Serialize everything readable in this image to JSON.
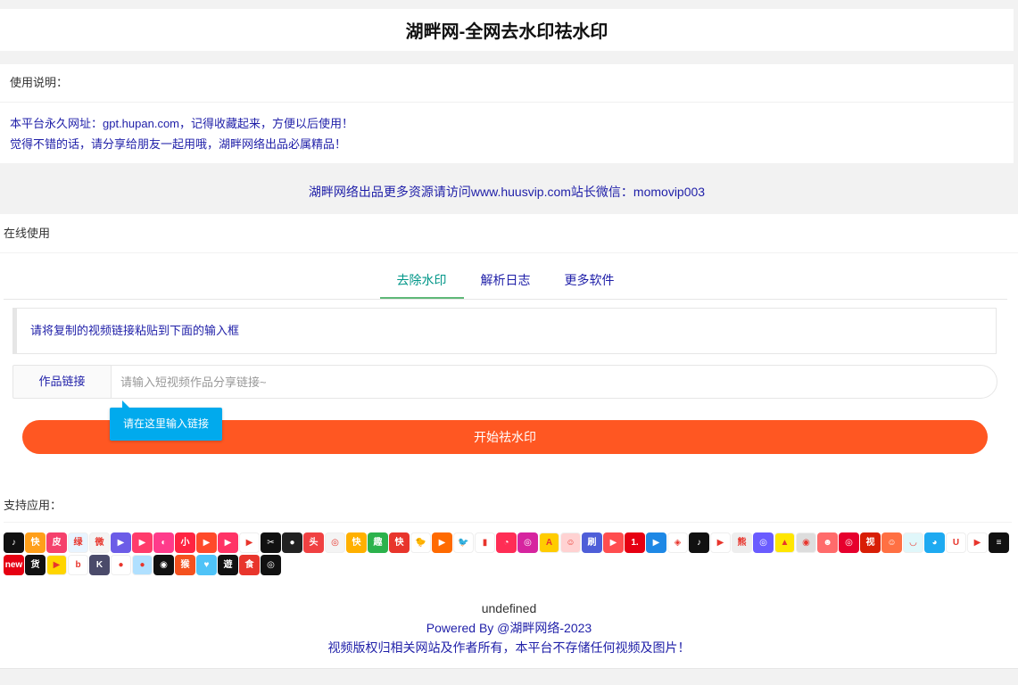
{
  "header": {
    "title": "湖畔网-全网去水印祛水印"
  },
  "notice": {
    "heading": "使用说明：",
    "line1": "本平台永久网址：gpt.hupan.com，记得收藏起来，方便以后使用！",
    "line2": "觉得不错的话，请分享给朋友一起用哦，湖畔网络出品必属精品！"
  },
  "promo": "湖畔网络出品更多资源请访问www.huusvip.com站长微信：momovip003",
  "online": {
    "heading": "在线使用",
    "tabs": [
      {
        "label": "去除水印",
        "active": true
      },
      {
        "label": "解析日志",
        "active": false
      },
      {
        "label": "更多软件",
        "active": false
      }
    ],
    "hint": "请将复制的视频链接粘贴到下面的输入框",
    "input_label": "作品链接",
    "input_placeholder": "请输入短视频作品分享链接~",
    "input_value": "",
    "tooltip": "请在这里输入链接",
    "start_button": "开始祛水印"
  },
  "support": {
    "heading": "支持应用：",
    "icons": [
      {
        "name": "douyin-icon",
        "bg": "#111111",
        "text": "♪"
      },
      {
        "name": "kuaishou-icon",
        "bg": "#ff9f1a",
        "text": "快"
      },
      {
        "name": "pipixia-icon",
        "bg": "#f5416c",
        "text": "皮"
      },
      {
        "name": "lvzhou-icon",
        "bg": "#e8f4ff",
        "text": "绿"
      },
      {
        "name": "weibo-icon",
        "bg": "#f4f4f4",
        "text": "微"
      },
      {
        "name": "weishi-icon",
        "bg": "#6c5ce7",
        "text": "▶"
      },
      {
        "name": "quanmin-icon",
        "bg": "#ff3b6b",
        "text": "▶"
      },
      {
        "name": "meipai-icon",
        "bg": "#ff3b8b",
        "text": "◐"
      },
      {
        "name": "xiaohongshu-icon",
        "bg": "#ff2442",
        "text": "小"
      },
      {
        "name": "haokan-icon",
        "bg": "#ff4a2a",
        "text": "▶"
      },
      {
        "name": "video-red-icon",
        "bg": "#ff3366",
        "text": "▶"
      },
      {
        "name": "play-icon",
        "bg": "#ffffff",
        "text": "▶"
      },
      {
        "name": "capcut-icon",
        "bg": "#111111",
        "text": "✂"
      },
      {
        "name": "record-icon",
        "bg": "#222222",
        "text": "●"
      },
      {
        "name": "toutiao-icon",
        "bg": "#f04142",
        "text": "头"
      },
      {
        "name": "qq-video-icon",
        "bg": "#f4f4f4",
        "text": "◎"
      },
      {
        "name": "kuaishou-yellow-icon",
        "bg": "#ffb000",
        "text": "快"
      },
      {
        "name": "qu-icon",
        "bg": "#2bb24c",
        "text": "趣"
      },
      {
        "name": "kuaibao-icon",
        "bg": "#e8352c",
        "text": "快"
      },
      {
        "name": "chick-icon",
        "bg": "#ffffff",
        "text": "🐤"
      },
      {
        "name": "play-orange-icon",
        "bg": "#ff6a00",
        "text": "▶"
      },
      {
        "name": "twitter-icon",
        "bg": "#ffffff",
        "text": "🐦"
      },
      {
        "name": "chart-icon",
        "bg": "#ffffff",
        "text": "▮"
      },
      {
        "name": "chat-icon",
        "bg": "#ff2d55",
        "text": "◔"
      },
      {
        "name": "instagram-icon",
        "bg": "#d6249f",
        "text": "◎"
      },
      {
        "name": "acfun-icon",
        "bg": "#ffcc00",
        "text": "A"
      },
      {
        "name": "face-icon",
        "bg": "#ffd2d2",
        "text": "☺"
      },
      {
        "name": "shua-icon",
        "bg": "#4e5ed8",
        "text": "刷"
      },
      {
        "name": "video-play-icon",
        "bg": "#ff4d4f",
        "text": "▶"
      },
      {
        "name": "one-icon",
        "bg": "#e60012",
        "text": "1."
      },
      {
        "name": "blue-play-icon",
        "bg": "#1e88e5",
        "text": "▶"
      },
      {
        "name": "iqiyi-icon",
        "bg": "#ffffff",
        "text": "◈"
      },
      {
        "name": "tiktok-icon",
        "bg": "#111111",
        "text": "♪"
      },
      {
        "name": "youtube-icon",
        "bg": "#ffffff",
        "text": "▶"
      },
      {
        "name": "panda-icon",
        "bg": "#eeeeee",
        "text": "熊"
      },
      {
        "name": "bubble-icon",
        "bg": "#6a5cff",
        "text": "◎"
      },
      {
        "name": "pear-icon",
        "bg": "#ffe600",
        "text": "▲"
      },
      {
        "name": "camera-icon",
        "bg": "#dddddd",
        "text": "◉"
      },
      {
        "name": "avatar-icon",
        "bg": "#ff6b6b",
        "text": "☻"
      },
      {
        "name": "netease-icon",
        "bg": "#e6002d",
        "text": "◎"
      },
      {
        "name": "shipin-icon",
        "bg": "#d81e06",
        "text": "视"
      },
      {
        "name": "girl-icon",
        "bg": "#ff7043",
        "text": "☺"
      },
      {
        "name": "bowl-icon",
        "bg": "#e0f7fa",
        "text": "◡"
      },
      {
        "name": "penguin-icon",
        "bg": "#1eaaf1",
        "text": "◕"
      },
      {
        "name": "uc-icon",
        "bg": "#ffffff",
        "text": "U"
      },
      {
        "name": "purple-play-icon",
        "bg": "#ffffff",
        "text": "▶"
      },
      {
        "name": "stripes-icon",
        "bg": "#111111",
        "text": "≡"
      },
      {
        "name": "new-icon",
        "bg": "#e60012",
        "text": "new"
      },
      {
        "name": "huoku-icon",
        "bg": "#111111",
        "text": "货"
      },
      {
        "name": "yellow-play-icon",
        "bg": "#ffd500",
        "text": "▶"
      },
      {
        "name": "b-icon",
        "bg": "#ffffff",
        "text": "b"
      },
      {
        "name": "k-icon",
        "bg": "#4a4a6a",
        "text": "K"
      },
      {
        "name": "pink-circle-icon",
        "bg": "#ffffff",
        "text": "●"
      },
      {
        "name": "sphere-icon",
        "bg": "#b0e0ff",
        "text": "●"
      },
      {
        "name": "eyes-icon",
        "bg": "#111111",
        "text": "◉"
      },
      {
        "name": "monkey-icon",
        "bg": "#f4511e",
        "text": "猴"
      },
      {
        "name": "heart-icon",
        "bg": "#4fc3f7",
        "text": "♥"
      },
      {
        "name": "yueyou-icon",
        "bg": "#111111",
        "text": "遊"
      },
      {
        "name": "food-icon",
        "bg": "#e8352c",
        "text": "食"
      },
      {
        "name": "ring-icon",
        "bg": "#111111",
        "text": "◎"
      }
    ]
  },
  "footer": {
    "undefined_text": "undefined",
    "powered": "Powered By @湖畔网络-2023",
    "copyright": "视频版权归相关网站及作者所有，本平台不存储任何视频及图片！"
  }
}
